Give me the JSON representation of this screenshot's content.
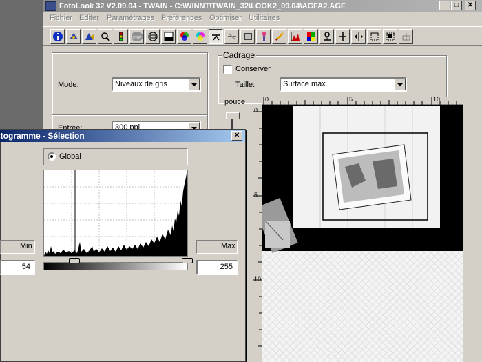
{
  "window": {
    "title": "FotoLook 32 V2.09.04 - TWAIN - C:\\WINNT\\TWAIN_32\\LOOK2_09.04\\AGFA2.AGF",
    "minimize": "_",
    "maximize": "□",
    "close": "✕"
  },
  "menu": [
    "Fichier",
    "Editer",
    "Paramétrages",
    "Préférences",
    "Optimiser",
    "Utilitaires"
  ],
  "toolbar": {
    "icons": [
      "info-icon",
      "scanner-icon",
      "preview-scan-icon",
      "zoom-icon",
      "traffic-light-icon",
      "stop-icon",
      "reset-icon",
      "density-icon",
      "rgb-icon",
      "cmy-icon",
      "gradation-icon",
      "sharpen-icon",
      "film-icon",
      "wand-icon",
      "pen-icon",
      "histogram-icon",
      "color-balance-icon",
      "descreen-icon",
      "move-icon",
      "resize-icon",
      "crop-icon",
      "crop-fit-icon",
      "mirror-icon"
    ]
  },
  "settings": {
    "mode_label": "Mode:",
    "mode_value": "Niveaux de gris",
    "input_label": "Entrée:",
    "input_value": "300 ppi"
  },
  "cadrage": {
    "title": "Cadrage",
    "keep_label": "Conserver",
    "size_label": "Taille:",
    "size_value": "Surface max.",
    "unit": "pouce"
  },
  "ruler": {
    "h_ticks": [
      "0",
      "5",
      "10"
    ],
    "v_ticks": [
      "0",
      "5",
      "10"
    ]
  },
  "dialog": {
    "title": "Histogramme - Sélection",
    "close": "✕",
    "option_label": "Global",
    "min_label": "Min",
    "max_label": "Max",
    "min_value": "54",
    "max_value": "255"
  },
  "colors": {
    "dialog_title": "#0a246a",
    "face": "#d4d0c8",
    "desktop": "#6b6b6b"
  }
}
